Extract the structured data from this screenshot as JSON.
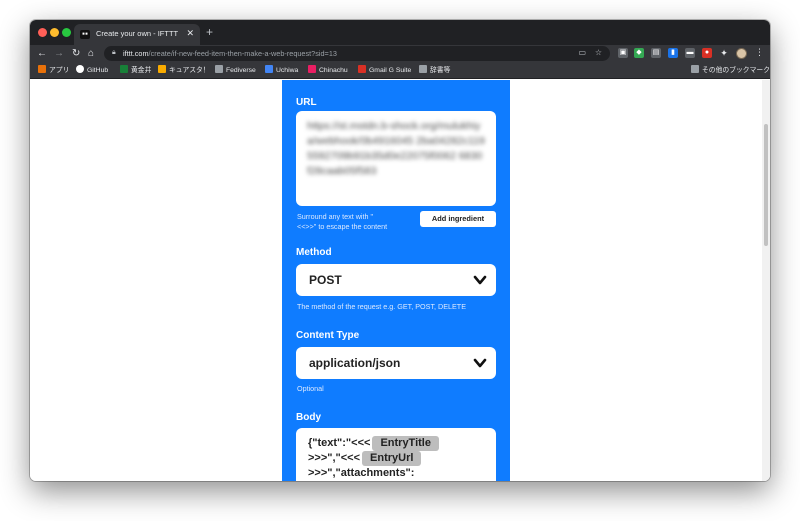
{
  "browser": {
    "tab": {
      "favicon": "ifttt-favicon",
      "title": "Create your own - IFTTT"
    },
    "address": {
      "host": "ifttt.com",
      "path": "/create/if-new-feed-item-then-make-a-web-request?sid=13"
    },
    "bookmarks": [
      {
        "label": "アプリ",
        "icon": "apps-grid-icon",
        "color": "#e8710a"
      },
      {
        "label": "GitHub",
        "icon": "github-icon",
        "color": "#ffffff"
      },
      {
        "label": "黄金井",
        "icon": "bookmark-green-icon",
        "color": "#188038"
      },
      {
        "label": "キュアスタ！",
        "icon": "bookmark-icon",
        "color": "#f9ab00"
      },
      {
        "label": "Fediverse",
        "icon": "folder-icon",
        "color": "#9aa0a6"
      },
      {
        "label": "Uchiwa",
        "icon": "uchiwa-icon",
        "color": "#4285f4"
      },
      {
        "label": "Chinachu",
        "icon": "chinachu-icon",
        "color": "#e91e63"
      },
      {
        "label": "Gmail G Suite",
        "icon": "gmail-icon",
        "color": "#d93025"
      },
      {
        "label": "辞書等",
        "icon": "folder-icon",
        "color": "#9aa0a6"
      }
    ],
    "other_bookmarks": "その他のブックマーク"
  },
  "form": {
    "url": {
      "label": "URL",
      "value": "https://st.mstdn.b-shock.org/mulukhiya/webhook/0b4916045 2ba04282c1195592709b91b35d0e22075f0062 6830f28caab05f583",
      "hint": "Surround any text with \"<<<\" and \">>>\" to escape the content",
      "hint_line1": "Surround any text with \"",
      "hint_line2": "<<>>\" to escape the content",
      "add_ingredient": "Add ingredient"
    },
    "method": {
      "label": "Method",
      "value": "POST",
      "hint": "The method of the request e.g. GET, POST, DELETE"
    },
    "content_type": {
      "label": "Content Type",
      "value": "application/json",
      "hint": "Optional"
    },
    "body": {
      "label": "Body",
      "line1_prefix": "{\"text\":\"<<<",
      "ingredient1": "EntryTitle",
      "line2_prefix": ">>>\",\"<<<",
      "ingredient2": "EntryUrl",
      "line3": ">>>\",\"attachments\":"
    }
  },
  "colors": {
    "panel": "#0f7cff",
    "chrome_dark": "#202124",
    "chrome": "#35363a"
  }
}
